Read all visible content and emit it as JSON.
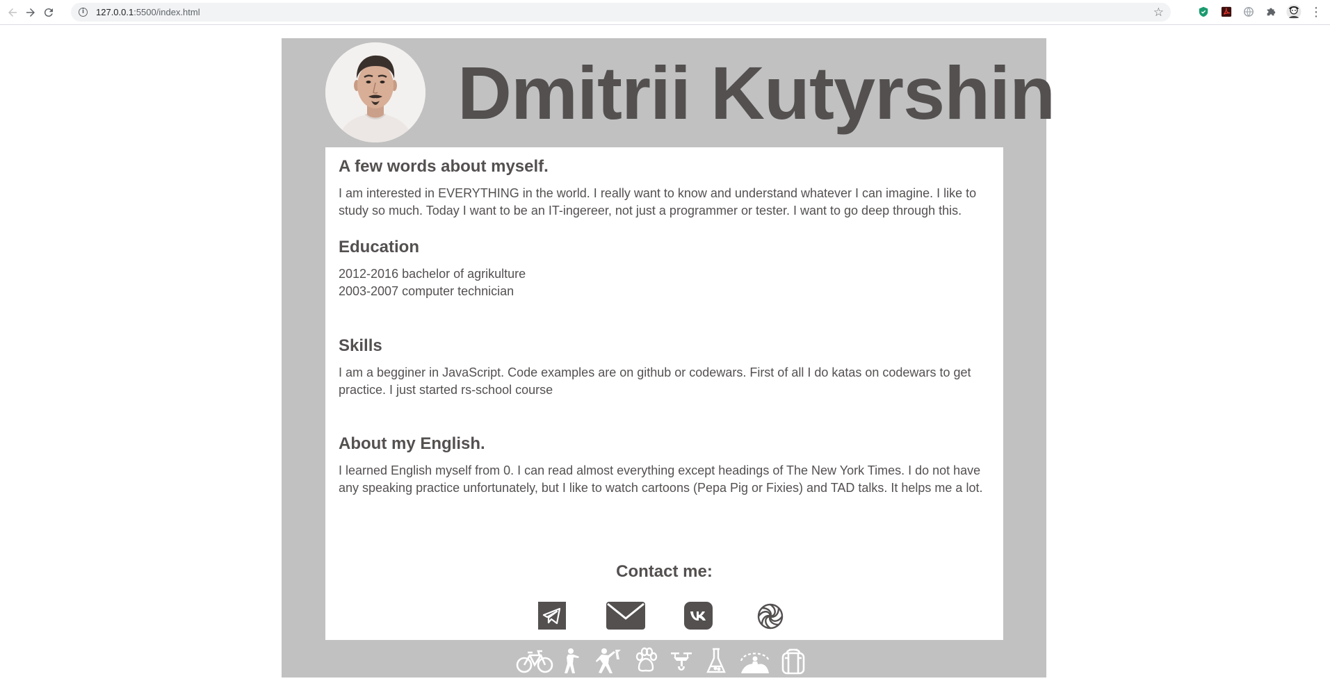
{
  "browser": {
    "url_host": "127.0.0.1",
    "url_path": ":5500/index.html",
    "info_glyph": "i",
    "star_glyph": "☆",
    "menu_glyph": "⋮"
  },
  "header": {
    "name": "Dmitrii Kutyrshin"
  },
  "sections": [
    {
      "title": "A few words about myself.",
      "text": "I am interested in EVERYTHING in the world. I really want to know and understand whatever I can imagine. I like to study so much. Today I want to be an IT-ingereer, not just a programmer or tester. I want to go deep through this."
    },
    {
      "title": "Education",
      "lines": [
        "2012-2016 bachelor of agrikulture",
        "2003-2007 computer technician"
      ]
    },
    {
      "title": "Skills",
      "text": "I am a begginer in JavaScript. Code examples are on github or codewars. First of all I do katas on codewars to get practice. I just started rs-school course"
    },
    {
      "title": "About my English.",
      "text": "I learned English myself from 0. I can read almost everything except headings of The New York Times. I do not have any speaking practice unfortunately, but I like to watch cartoons (Pepa Pig or Fixies) and TAD talks. It helps me a lot."
    }
  ],
  "contact": {
    "title": "Contact me:",
    "icons": [
      "telegram-icon",
      "mail-icon",
      "vk-icon",
      "codewars-icon"
    ]
  },
  "hobbies": [
    "bicycle-icon",
    "shooter-icon",
    "climber-icon",
    "paw-icon",
    "drone-icon",
    "flask-icon",
    "skydiver-icon",
    "backpack-icon"
  ],
  "colors": {
    "frame_bg": "#c1c1c1",
    "text": "#545050",
    "card_bg": "#ffffff",
    "hobby_icon": "#ffffff"
  }
}
